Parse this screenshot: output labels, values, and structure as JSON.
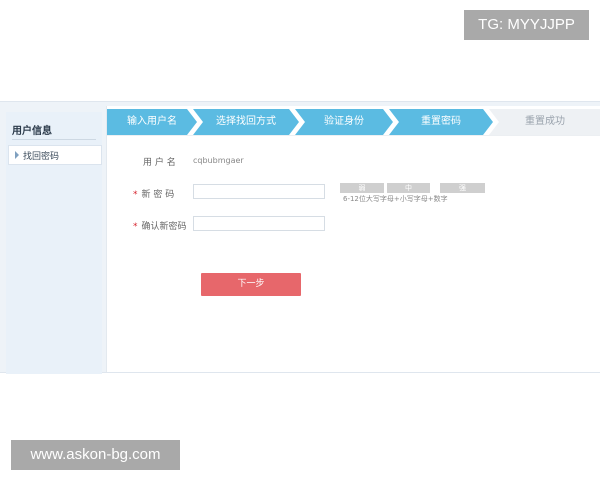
{
  "watermarks": {
    "top": "TG: MYYJJPP",
    "bottom": "www.askon-bg.com"
  },
  "sidebar": {
    "title": "用户信息",
    "items": [
      {
        "label": "找回密码"
      }
    ]
  },
  "steps": [
    {
      "label": "输入用户名",
      "state": "done"
    },
    {
      "label": "选择找回方式",
      "state": "done"
    },
    {
      "label": "验证身份",
      "state": "done"
    },
    {
      "label": "重置密码",
      "state": "current"
    },
    {
      "label": "重置成功",
      "state": "pending"
    }
  ],
  "form": {
    "username_label": "用 户 名",
    "username_value": "cqbubmgaer",
    "required_mark": "*",
    "new_password_label": "新 密 码",
    "new_password_value": "",
    "confirm_password_label": "确认新密码",
    "confirm_password_value": "",
    "strength": {
      "weak": "弱",
      "medium": "中",
      "strong": "强"
    },
    "strength_hint": "6-12位大写字母+小写字母+数字",
    "next_button": "下一步"
  },
  "colors": {
    "step_active": "#5bbbe2",
    "step_inactive": "#eef1f4",
    "button": "#e7676b",
    "required": "#d6252f",
    "watermark_bg": "#a9a9a9"
  }
}
